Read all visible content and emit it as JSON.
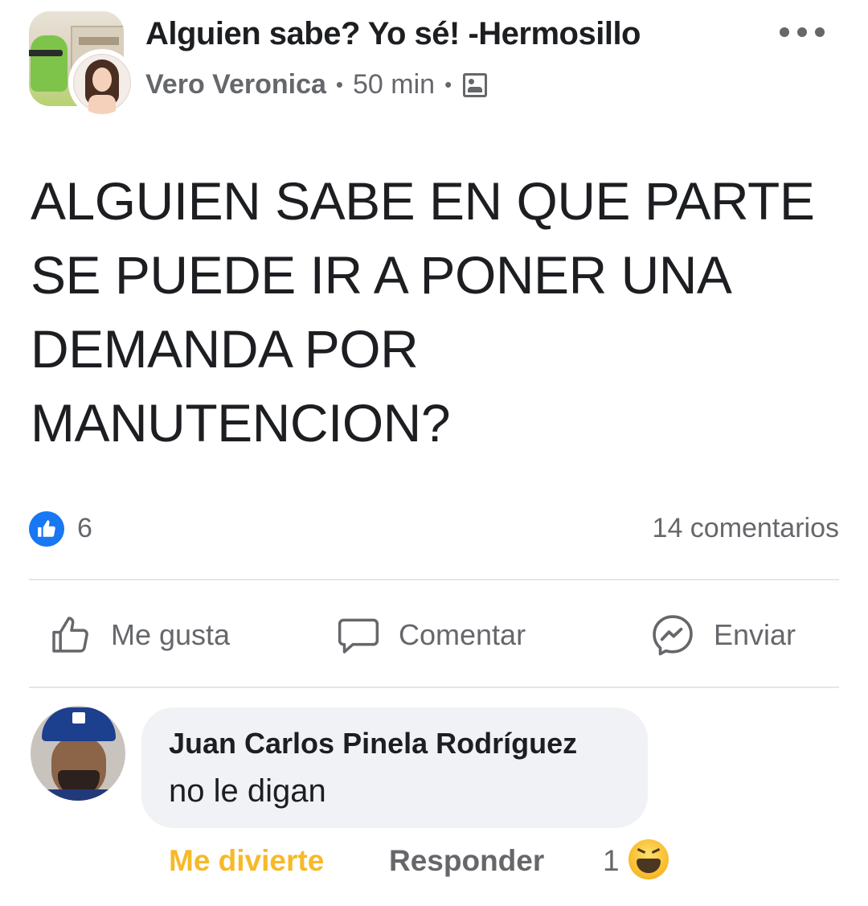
{
  "post": {
    "group_name": "Alguien sabe? Yo sé! -Hermosillo",
    "author": "Vero Veronica",
    "separator": "•",
    "time": "50 min",
    "body": "ALGUIEN SABE EN QUE PARTE SE PUEDE IR A PONER UNA DEMANDA POR MANUTENCION?",
    "likes": "6",
    "comments": "14 comentarios"
  },
  "actions": {
    "like": "Me gusta",
    "comment": "Comentar",
    "send": "Enviar"
  },
  "comment": {
    "author": "Juan Carlos Pinela Rodríguez",
    "text": "no le digan",
    "reaction_label": "Me divierte",
    "reply_label": "Responder",
    "reaction_count": "1"
  },
  "icons": {
    "group_avatar": "group-avatar-image",
    "user_avatar": "user-avatar-image",
    "privacy": "group-privacy-icon",
    "more": "more-options-icon",
    "like_badge": "like-reaction-icon",
    "like_action": "thumbs-up-icon",
    "comment_action": "speech-bubble-icon",
    "send_action": "messenger-icon",
    "haha": "haha-reaction-icon"
  },
  "colors": {
    "brand_blue": "#1877f2",
    "secondary_text": "#65676b",
    "haha_yellow": "#f7b928",
    "bubble_bg": "#f0f2f5"
  }
}
